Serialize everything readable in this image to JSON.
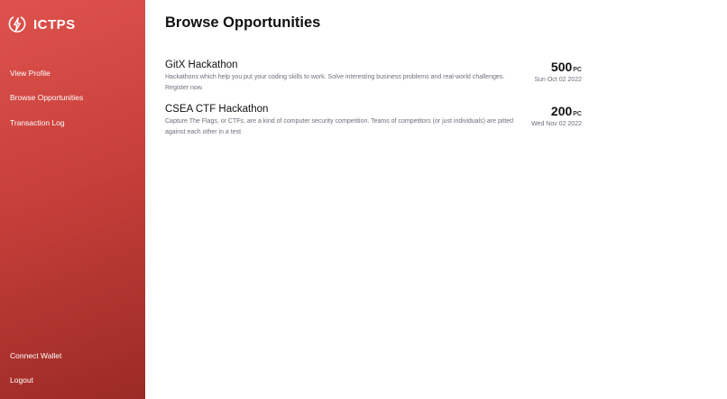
{
  "app": {
    "name": "ICTPS",
    "logo_icon": "lightning-circle-icon"
  },
  "sidebar": {
    "top_items": [
      {
        "label": "View Profile"
      },
      {
        "label": "Browse Opportunities"
      },
      {
        "label": "Transaction Log"
      }
    ],
    "bottom_items": [
      {
        "label": "Connect Wallet"
      },
      {
        "label": "Logout"
      }
    ]
  },
  "main": {
    "title": "Browse Opportunities",
    "opportunities": [
      {
        "title": "GitX Hackathon",
        "description": "Hackathons which help you put your coding skills to work. Solve interesting business problems and real-world challenges. Register now.",
        "amount": "500",
        "unit": "PC",
        "date": "Sun Oct 02 2022"
      },
      {
        "title": "CSEA CTF Hackathon",
        "description": "Capture The Flags, or CTFs, are a kind of computer security competition. Teams of competitors (or just individuals) are pitted against each other in a test",
        "amount": "200",
        "unit": "PC",
        "date": "Wed Nov 02 2022"
      }
    ]
  },
  "colors": {
    "sidebar_start": "#de524d",
    "sidebar_end": "#9b2a25",
    "text_primary": "#111111",
    "text_secondary": "#6b6f7c"
  }
}
